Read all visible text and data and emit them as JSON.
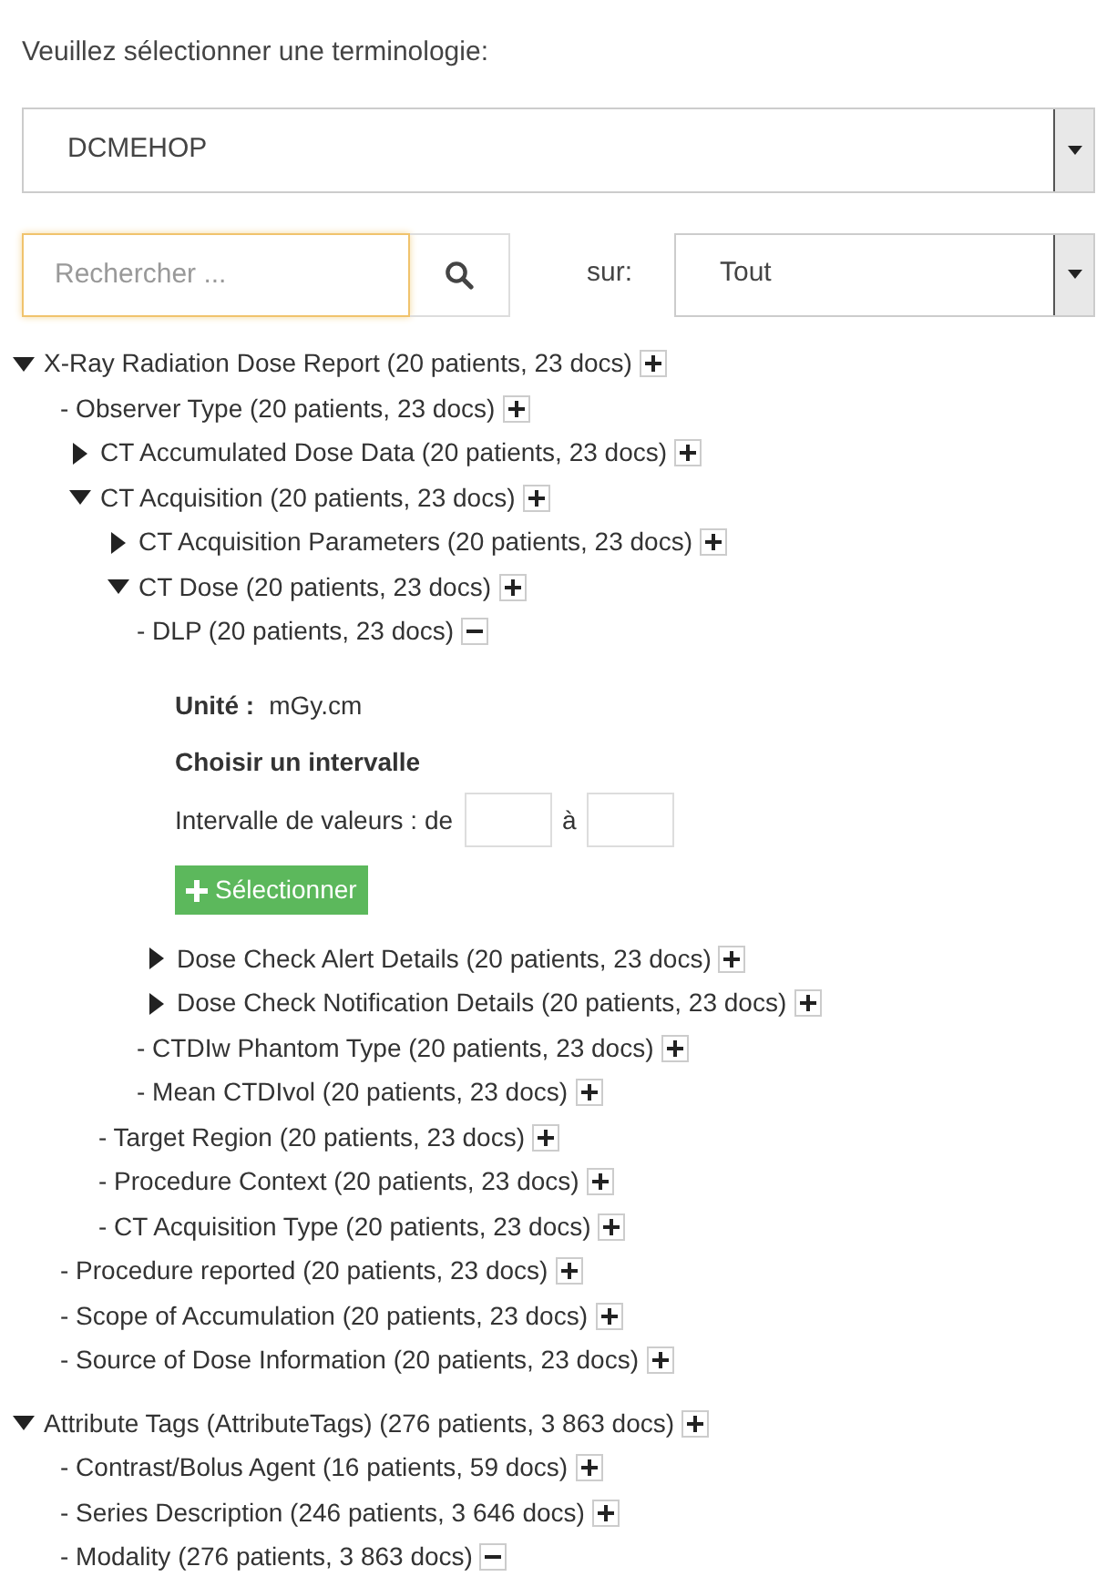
{
  "prompt": "Veuillez sélectionner une terminologie:",
  "terminology_select": {
    "value": "DCMEHOP"
  },
  "search": {
    "placeholder": "Rechercher ...",
    "scope_label": "sur:",
    "scope_value": "Tout"
  },
  "tree": [
    {
      "kind": "branch",
      "label": "X-Ray Radiation Dose Report (20 patients, 23 docs)",
      "expanded": true,
      "panel_open": false,
      "children": [
        {
          "kind": "leaf",
          "label": "- Observer Type (20 patients, 23 docs)",
          "panel_open": false
        },
        {
          "kind": "branch",
          "label": "CT Accumulated Dose Data (20 patients, 23 docs)",
          "expanded": false,
          "panel_open": false
        },
        {
          "kind": "branch",
          "label": "CT Acquisition (20 patients, 23 docs)",
          "expanded": true,
          "panel_open": false,
          "children": [
            {
              "kind": "branch",
              "label": "CT Acquisition Parameters (20 patients, 23 docs)",
              "expanded": false,
              "panel_open": false
            },
            {
              "kind": "branch",
              "label": "CT Dose (20 patients, 23 docs)",
              "expanded": true,
              "panel_open": false,
              "children": [
                {
                  "kind": "leaf",
                  "label": "- DLP (20 patients, 23 docs)",
                  "panel_open": true,
                  "details": {
                    "unit_label": "Unité :",
                    "unit_value": "mGy.cm",
                    "heading": "Choisir un intervalle",
                    "range_label": "Intervalle de valeurs : de",
                    "range_to": "à",
                    "button": "Sélectionner"
                  }
                },
                {
                  "kind": "branch",
                  "label": "Dose Check Alert Details (20 patients, 23 docs)",
                  "expanded": false,
                  "panel_open": false
                },
                {
                  "kind": "branch",
                  "label": "Dose Check Notification Details (20 patients, 23 docs)",
                  "expanded": false,
                  "panel_open": false
                },
                {
                  "kind": "leaf",
                  "label": "- CTDIw Phantom Type (20 patients, 23 docs)",
                  "panel_open": false
                },
                {
                  "kind": "leaf",
                  "label": "- Mean CTDIvol (20 patients, 23 docs)",
                  "panel_open": false
                }
              ]
            },
            {
              "kind": "leaf",
              "label": "- Target Region (20 patients, 23 docs)",
              "panel_open": false
            },
            {
              "kind": "leaf",
              "label": "- Procedure Context (20 patients, 23 docs)",
              "panel_open": false
            },
            {
              "kind": "leaf",
              "label": "- CT Acquisition Type (20 patients, 23 docs)",
              "panel_open": false
            }
          ]
        },
        {
          "kind": "leaf",
          "label": "- Procedure reported (20 patients, 23 docs)",
          "panel_open": false
        },
        {
          "kind": "leaf",
          "label": "- Scope of Accumulation (20 patients, 23 docs)",
          "panel_open": false
        },
        {
          "kind": "leaf",
          "label": "- Source of Dose Information (20 patients, 23 docs)",
          "panel_open": false
        }
      ]
    },
    {
      "kind": "branch",
      "label": "Attribute Tags (AttributeTags) (276 patients, 3 863 docs)",
      "expanded": true,
      "panel_open": false,
      "children": [
        {
          "kind": "leaf",
          "label": "- Contrast/Bolus Agent (16 patients, 59 docs)",
          "panel_open": false
        },
        {
          "kind": "leaf",
          "label": "- Series Description (246 patients, 3 646 docs)",
          "panel_open": false
        },
        {
          "kind": "leaf",
          "label": "- Modality (276 patients, 3 863 docs)",
          "panel_open": true
        }
      ]
    }
  ]
}
